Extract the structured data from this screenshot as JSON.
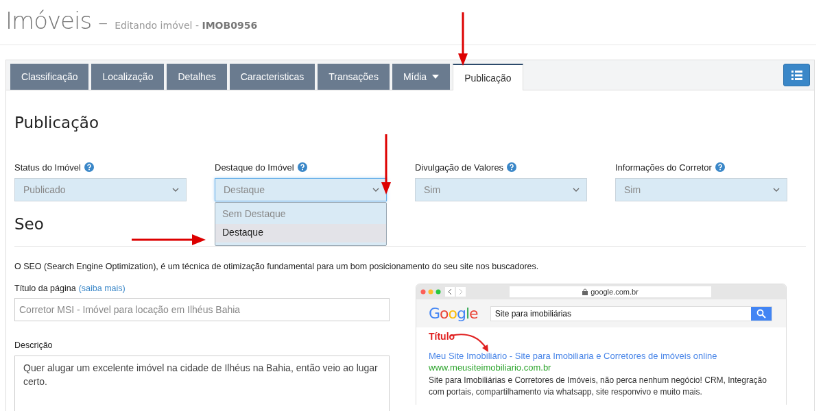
{
  "header": {
    "title": "Imóveis",
    "separator": "–",
    "subtitle": "Editando imóvel - **IMOB0956**"
  },
  "tabs": [
    {
      "label": "Classificação",
      "selected": false,
      "dropdown": false
    },
    {
      "label": "Localização",
      "selected": false,
      "dropdown": false
    },
    {
      "label": "Detalhes",
      "selected": false,
      "dropdown": false
    },
    {
      "label": "Caracteristicas",
      "selected": false,
      "dropdown": false
    },
    {
      "label": "Transações",
      "selected": false,
      "dropdown": false
    },
    {
      "label": "Mídia",
      "selected": false,
      "dropdown": true
    },
    {
      "label": "Publicação",
      "selected": true,
      "dropdown": false
    }
  ],
  "section_title": "Publicação",
  "selects": [
    {
      "label": "Status do Imóvel",
      "value": "Publicado",
      "open": false
    },
    {
      "label": "Destaque do Imóvel",
      "value": "Destaque",
      "open": true,
      "options": [
        {
          "label": "Sem Destaque",
          "selected": false
        },
        {
          "label": "Destaque",
          "selected": true
        }
      ]
    },
    {
      "label": "Divulgação de Valores",
      "value": "Sim",
      "open": false
    },
    {
      "label": "Informações do Corretor",
      "value": "Sim",
      "open": false
    }
  ],
  "seo": {
    "title": "Seo",
    "description": "O SEO (Search Engine Optimization), é um técnica de otimização fundamental para um bom posicionamento do seu site nos buscadores.",
    "page_title_label": "Título da página",
    "page_title_link": "(saiba mais)",
    "page_title_placeholder": "Corretor MSI - Imóvel para locação em Ilhéus Bahia",
    "description_label": "Descrição",
    "description_value": "Quer alugar um excelente imóvel na cidade de Ilhéus na Bahia, então veio ao lugar certo."
  },
  "preview": {
    "address": "google.com.br",
    "logo": "Google",
    "query": "Site para imobiliárias",
    "annotation": "Título",
    "result_title": "Meu Site Imobiliário - Site para Imobiliaria e Corretores de imóveis online",
    "result_url": "www.meusiteimobiliario.com.br",
    "result_snippet": "Site para Imobiliárias e Corretores de Imóveis, não perca nenhum negócio! CRM, Integração com portais, compartilhamento via whatsapp, site responvivo e muito mais."
  }
}
